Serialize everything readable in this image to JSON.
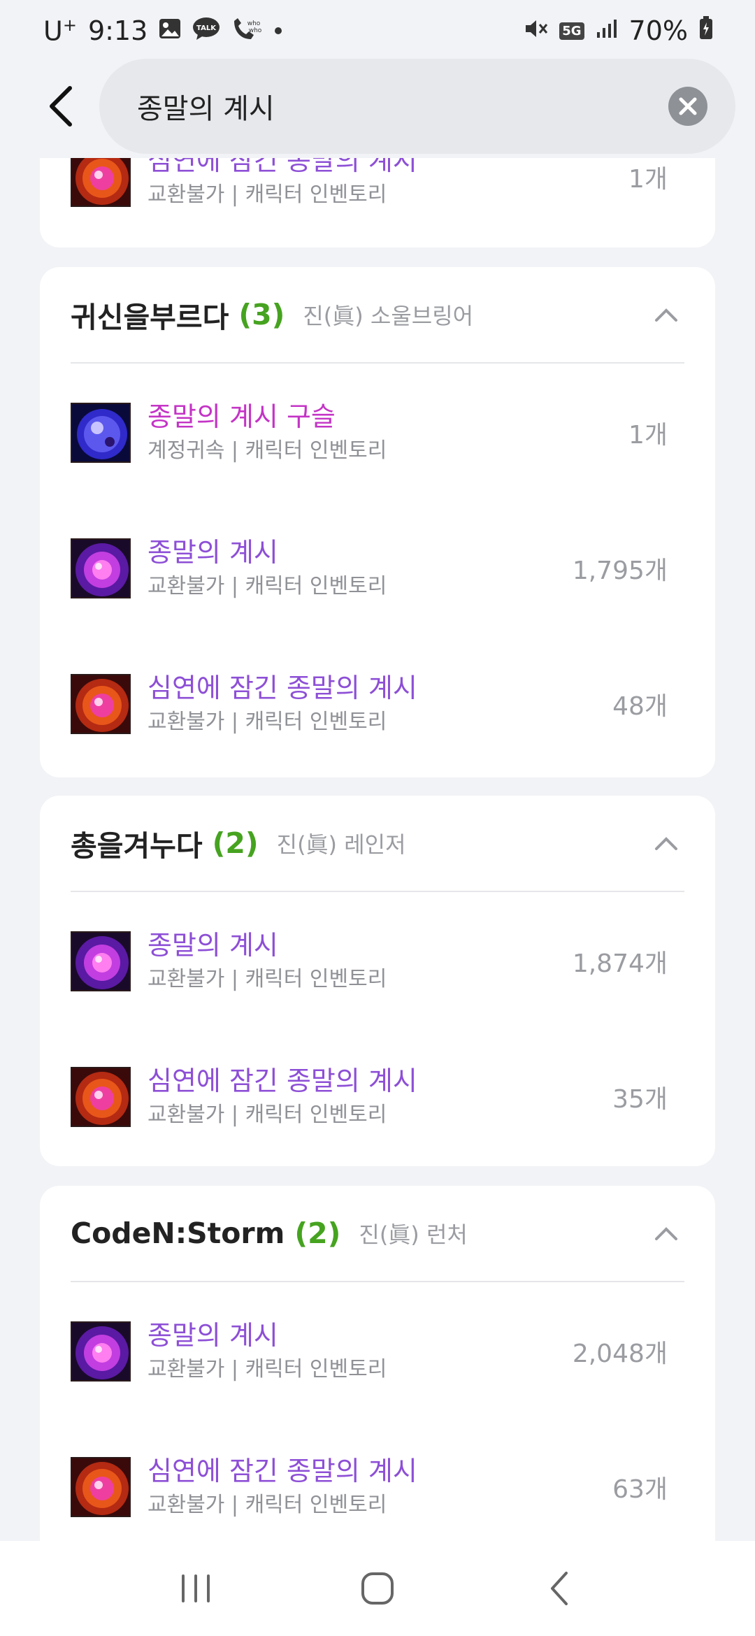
{
  "status_bar": {
    "carrier": "U",
    "carrier_sup": "+",
    "time": "9:13",
    "network": "5G",
    "battery": "70%"
  },
  "search": {
    "query": "종말의 계시"
  },
  "groups": [
    {
      "items": [
        {
          "name": "심연에 잠긴 종말의 계시",
          "meta": "교환불가 | 캐릭터 인벤토리",
          "qty": "1개",
          "icon": "abyss-revelation-icon"
        }
      ]
    },
    {
      "name": "귀신을부르다",
      "count": "(3)",
      "class": "진(眞) 소울브링어",
      "items": [
        {
          "name": "종말의 계시 구슬",
          "meta": "계정귀속 | 캐릭터 인벤토리",
          "qty": "1개",
          "icon": "revelation-orb-icon"
        },
        {
          "name": "종말의 계시",
          "meta": "교환불가 | 캐릭터 인벤토리",
          "qty": "1,795개",
          "icon": "revelation-icon"
        },
        {
          "name": "심연에 잠긴 종말의 계시",
          "meta": "교환불가 | 캐릭터 인벤토리",
          "qty": "48개",
          "icon": "abyss-revelation-icon"
        }
      ]
    },
    {
      "name": "총을겨누다",
      "count": "(2)",
      "class": "진(眞) 레인저",
      "items": [
        {
          "name": "종말의 계시",
          "meta": "교환불가 | 캐릭터 인벤토리",
          "qty": "1,874개",
          "icon": "revelation-icon"
        },
        {
          "name": "심연에 잠긴 종말의 계시",
          "meta": "교환불가 | 캐릭터 인벤토리",
          "qty": "35개",
          "icon": "abyss-revelation-icon"
        }
      ]
    },
    {
      "name": "CodeN:Storm",
      "count": "(2)",
      "class": "진(眞) 런처",
      "items": [
        {
          "name": "종말의 계시",
          "meta": "교환불가 | 캐릭터 인벤토리",
          "qty": "2,048개",
          "icon": "revelation-icon"
        },
        {
          "name": "심연에 잠긴 종말의 계시",
          "meta": "교환불가 | 캐릭터 인벤토리",
          "qty": "63개",
          "icon": "abyss-revelation-icon"
        }
      ]
    }
  ],
  "colors": {
    "item_purple": "#8d4fd6",
    "item_magenta": "#c434c6",
    "count_green": "#46a320",
    "background": "#f2f3f6"
  },
  "nav": [
    "recent-apps",
    "home",
    "back"
  ]
}
